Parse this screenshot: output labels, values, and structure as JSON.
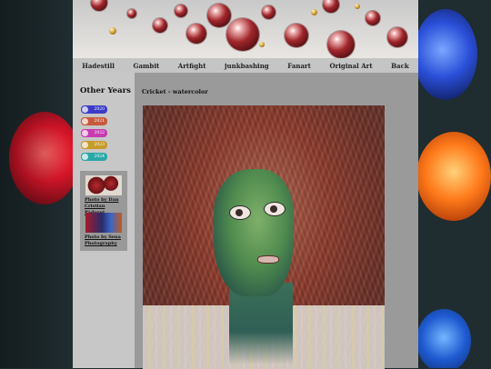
{
  "nav": {
    "items": [
      "Hadestill",
      "Gambit",
      "Artfight",
      "junkbashing",
      "Fanart",
      "Original Art",
      "Back"
    ]
  },
  "sidebar": {
    "title": "Other Years",
    "years": [
      {
        "label": "2020",
        "color": "#3b3bc8"
      },
      {
        "label": "2021",
        "color": "#c85a3b"
      },
      {
        "label": "2022",
        "color": "#c83bb0"
      },
      {
        "label": "2023",
        "color": "#c89a2a"
      },
      {
        "label": "2024",
        "color": "#2aa7a7"
      }
    ],
    "credits": [
      {
        "text": "Photo by Dan Cristian Pădureț"
      },
      {
        "text": "Photo by Sena Photography"
      }
    ]
  },
  "content": {
    "title": "Cricket - watercolor"
  },
  "colors": {
    "page_bg": "#d1d1d1",
    "content_bg": "#9a9a9a"
  }
}
